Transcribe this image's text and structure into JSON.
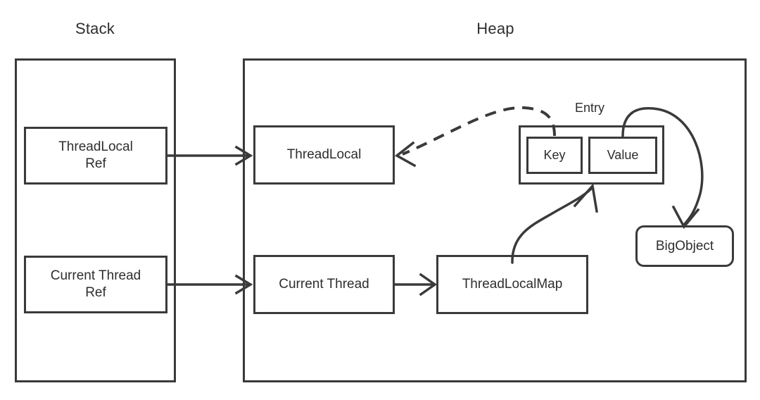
{
  "diagram": {
    "title_stack": "Stack",
    "title_heap": "Heap",
    "entry_label": "Entry",
    "stroke_color": "#3a3a3a",
    "text_color": "#2e2e2e",
    "background_color": "#ffffff",
    "nodes": {
      "threadlocal_ref": "ThreadLocal\nRef",
      "current_thread_ref": "Current Thread\nRef",
      "threadlocal": "ThreadLocal",
      "current_thread": "Current Thread",
      "threadlocalmap": "ThreadLocalMap",
      "entry_key": "Key",
      "entry_value": "Value",
      "bigobject": "BigObject"
    },
    "edges": [
      {
        "name": "threadlocal-ref-to-threadlocal",
        "from": "ThreadLocal Ref",
        "to": "ThreadLocal",
        "style": "solid"
      },
      {
        "name": "current-thread-ref-to-current-thread",
        "from": "Current Thread Ref",
        "to": "Current Thread",
        "style": "solid"
      },
      {
        "name": "current-thread-to-threadlocalmap",
        "from": "Current Thread",
        "to": "ThreadLocalMap",
        "style": "solid"
      },
      {
        "name": "threadlocalmap-to-entry",
        "from": "ThreadLocalMap",
        "to": "Entry",
        "style": "solid-curved"
      },
      {
        "name": "key-to-threadlocal",
        "from": "Key",
        "to": "ThreadLocal",
        "style": "dashed-curved"
      },
      {
        "name": "value-to-bigobject",
        "from": "Value",
        "to": "BigObject",
        "style": "solid-curved"
      }
    ]
  }
}
